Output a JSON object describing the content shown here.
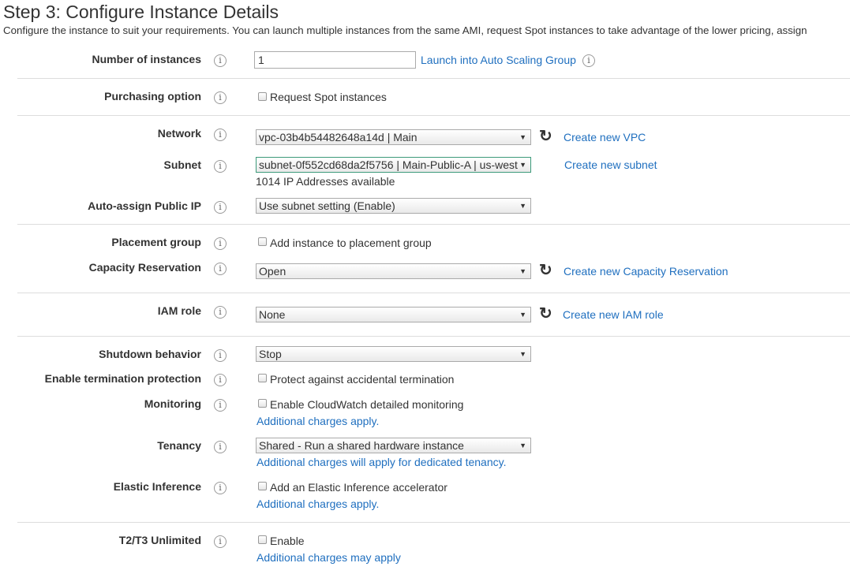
{
  "header": {
    "title": "Step 3: Configure Instance Details",
    "description": "Configure the instance to suit your requirements. You can launch multiple instances from the same AMI, request Spot instances to take advantage of the lower pricing, assign"
  },
  "info_glyph": "i",
  "fields": {
    "num_instances": {
      "label": "Number of instances",
      "value": "1",
      "link": "Launch into Auto Scaling Group"
    },
    "purchasing": {
      "label": "Purchasing option",
      "checkbox": "Request Spot instances"
    },
    "network": {
      "label": "Network",
      "value": "vpc-03b4b54482648a14d | Main",
      "link": "Create new VPC"
    },
    "subnet": {
      "label": "Subnet",
      "value": "subnet-0f552cd68da2f5756 | Main-Public-A | us-west",
      "note": "1014 IP Addresses available",
      "link": "Create new subnet"
    },
    "public_ip": {
      "label": "Auto-assign Public IP",
      "value": "Use subnet setting (Enable)"
    },
    "placement": {
      "label": "Placement group",
      "checkbox": "Add instance to placement group"
    },
    "capacity": {
      "label": "Capacity Reservation",
      "value": "Open",
      "link": "Create new Capacity Reservation"
    },
    "iam": {
      "label": "IAM role",
      "value": "None",
      "link": "Create new IAM role"
    },
    "shutdown": {
      "label": "Shutdown behavior",
      "value": "Stop"
    },
    "termination": {
      "label": "Enable termination protection",
      "checkbox": "Protect against accidental termination"
    },
    "monitoring": {
      "label": "Monitoring",
      "checkbox": "Enable CloudWatch detailed monitoring",
      "link": "Additional charges apply."
    },
    "tenancy": {
      "label": "Tenancy",
      "value": "Shared - Run a shared hardware instance",
      "link": "Additional charges will apply for dedicated tenancy."
    },
    "elastic": {
      "label": "Elastic Inference",
      "checkbox": "Add an Elastic Inference accelerator",
      "link": "Additional charges apply."
    },
    "t2t3": {
      "label": "T2/T3 Unlimited",
      "checkbox": "Enable",
      "link": "Additional charges may apply"
    }
  },
  "icons": {
    "info": "info-icon",
    "refresh": "refresh-icon",
    "dropdown": "chevron-down-icon"
  },
  "colors": {
    "link": "#1f6fbf",
    "active_border": "#3c9a7a",
    "label": "#333333"
  }
}
